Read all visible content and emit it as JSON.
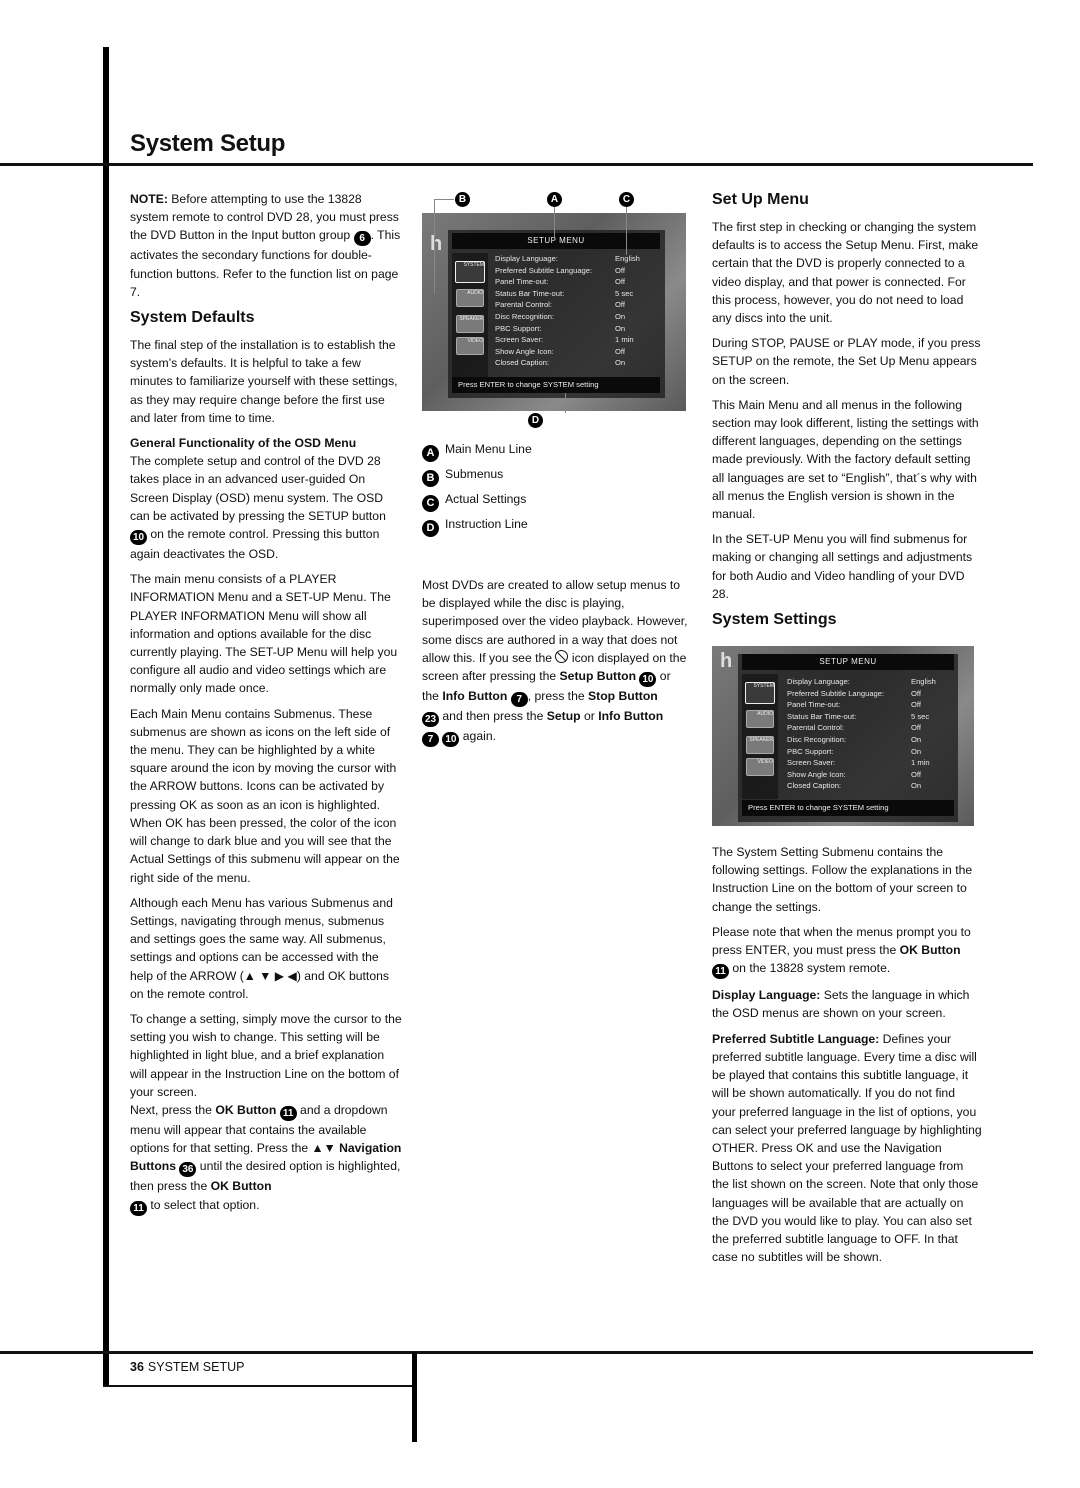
{
  "page": {
    "title": "System Setup",
    "footer": {
      "page_number": "36",
      "section": "SYSTEM SETUP"
    }
  },
  "col1": {
    "note_label": "NOTE:",
    "note_text": " Before attempting to use the 13828 system remote to control DVD 28, you must press the DVD Button in the Input button group ",
    "note_num": "6",
    "note_tail": ". This activates the secondary functions for double-function buttons. Refer to the function list on page 7.",
    "h_defaults": "System Defaults",
    "p_defaults": "The final step of the installation is to establish the system’s defaults. It is helpful to take a few minutes to familiarize yourself with these settings, as they may require change before the first use and later from time to time.",
    "h_general": "General Functionality of the OSD Menu",
    "p_general_a": "The complete setup and control of the DVD 28 takes place in an advanced user-guided On Screen Display (OSD) menu system. The OSD can be activated by pressing the SETUP button ",
    "p_general_num": "10",
    "p_general_b": " on the remote control. Pressing this button again deactivates the OSD.",
    "p_main": "The main menu consists of a PLAYER INFORMATION Menu and a SET-UP Menu. The PLAYER INFORMATION Menu will show all information and options available for the disc currently playing. The SET-UP Menu will help you configure all audio and video settings which are normally only made once.",
    "p_sub": "Each Main Menu contains Submenus. These submenus are shown as icons on the left side of the menu. They can be highlighted by a white square around the icon by moving the cursor with the ARROW buttons. Icons can be activated by pressing OK as soon as an icon is highlighted. When OK has been pressed, the color of the icon will change to dark blue and you will see that the Actual Settings of this submenu will appear on the right side of the menu.",
    "p_nav_a": "Although each Menu has various Submenus and Settings, navigating through menus, submenus and settings goes the same way. All submenus, settings and options can be accessed with the help of the ARROW (",
    "p_nav_arrows": "▲ ▼ ▶ ◀",
    "p_nav_b": ") and OK buttons on the remote control.",
    "p_change": "To change a setting, simply move the cursor to the setting you wish to change. This setting will be highlighted in light blue, and a brief explanation will appear in the Instruction Line on the bottom of your screen.",
    "p_next_a": "Next, press the ",
    "p_next_ok": "OK Button",
    "p_next_num1": "11",
    "p_next_b": " and a dropdown menu will appear that contains the available options for that setting. Press the ▲▼ ",
    "p_next_nav": "Navigation Buttons",
    "p_next_num2": "36",
    "p_next_c": " until the desired option is highlighted, then press the ",
    "p_next_ok2": "OK Button",
    "p_next_num3": "11",
    "p_next_d": " to select that option."
  },
  "osd": {
    "title": "SETUP MENU",
    "rows": [
      {
        "label": "Display Language:",
        "value": "English"
      },
      {
        "label": "Preferred Subtitle Language:",
        "value": "Off"
      },
      {
        "label": "Panel Time-out:",
        "value": "Off"
      },
      {
        "label": "Status Bar Time-out:",
        "value": "5 sec"
      },
      {
        "label": "Parental Control:",
        "value": "Off"
      },
      {
        "label": "Disc Recognition:",
        "value": "On"
      },
      {
        "label": "PBC Support:",
        "value": "On"
      },
      {
        "label": "Screen Saver:",
        "value": "1 min"
      },
      {
        "label": "Show Angle Icon:",
        "value": "Off"
      },
      {
        "label": "Closed Caption:",
        "value": "On"
      }
    ],
    "icons": [
      "SYSTEM",
      "AUDIO",
      "SPEAKER",
      "VIDEO"
    ],
    "instruction": "Press ENTER to change SYSTEM setting",
    "letter": "h",
    "callouts": {
      "a": "A",
      "b": "B",
      "c": "C",
      "d": "D"
    }
  },
  "col2": {
    "legend": [
      {
        "key": "A",
        "label": "Main Menu Line"
      },
      {
        "key": "B",
        "label": "Submenus"
      },
      {
        "key": "C",
        "label": "Actual Settings"
      },
      {
        "key": "D",
        "label": "Instruction Line"
      }
    ],
    "p_a": "Most DVDs are created to allow setup menus to be displayed while the disc is playing, superimposed over the video playback. However, some discs are authored in a way that does not allow this. If you see the ",
    "p_b": " icon displayed on the screen after pressing the ",
    "setup_btn": "Setup Button",
    "n10": "10",
    "p_c": " or the ",
    "info_btn": "Info Button",
    "n7": "7",
    "p_d": ", press the ",
    "stop_btn": "Stop Button",
    "n23": "23",
    "p_e": " and then press the ",
    "setup": "Setup",
    "p_f": " or ",
    "info_btn2": "Info Button",
    "p_g": " again."
  },
  "col3": {
    "h_setup": "Set Up Menu",
    "p1": "The first step in checking or changing the system defaults is to access the Setup Menu. First, make certain that the DVD is properly connected to a video display, and that power is connected. For this process, however, you do not need to load any discs into the unit.",
    "p2": "During STOP, PAUSE or PLAY mode, if you press SETUP on the remote, the Set Up Menu appears on the screen.",
    "p3": "This Main Menu and all menus in the following section may look different, listing the settings with different languages, depending on the settings made previously. With the factory default setting all languages are set to “English”, that´s why with all menus the English version is shown in the manual.",
    "p4": "In the SET-UP Menu you will find submenus for making or changing all settings and adjustments for both Audio and Video handling of your DVD 28.",
    "h_settings": "System Settings",
    "p5": "The System Setting Submenu contains the following settings. Follow the explanations in the Instruction Line on the bottom of your screen to change the settings.",
    "p6_a": "Please note that when the menus prompt you to press ENTER, you must press the ",
    "p6_ok": "OK Button",
    "p6_num": "11",
    "p6_b": " on the 13828 system remote.",
    "p7_label": "Display Language:",
    "p7_text": " Sets the language in which the OSD menus are shown on your screen.",
    "p8_label": "Preferred Subtitle Language:",
    "p8_text": " Defines your preferred subtitle language. Every time a disc will be played that contains this subtitle language, it will be shown automatically. If you do not find your preferred language in the list of options, you can select your preferred language by highlighting OTHER. Press OK and use the Navigation Buttons to select your preferred language from the list shown on the screen. Note that only those languages will be available that are actually on the DVD you would like to play. You can also set the preferred subtitle language to OFF. In that case no subtitles will be shown."
  }
}
